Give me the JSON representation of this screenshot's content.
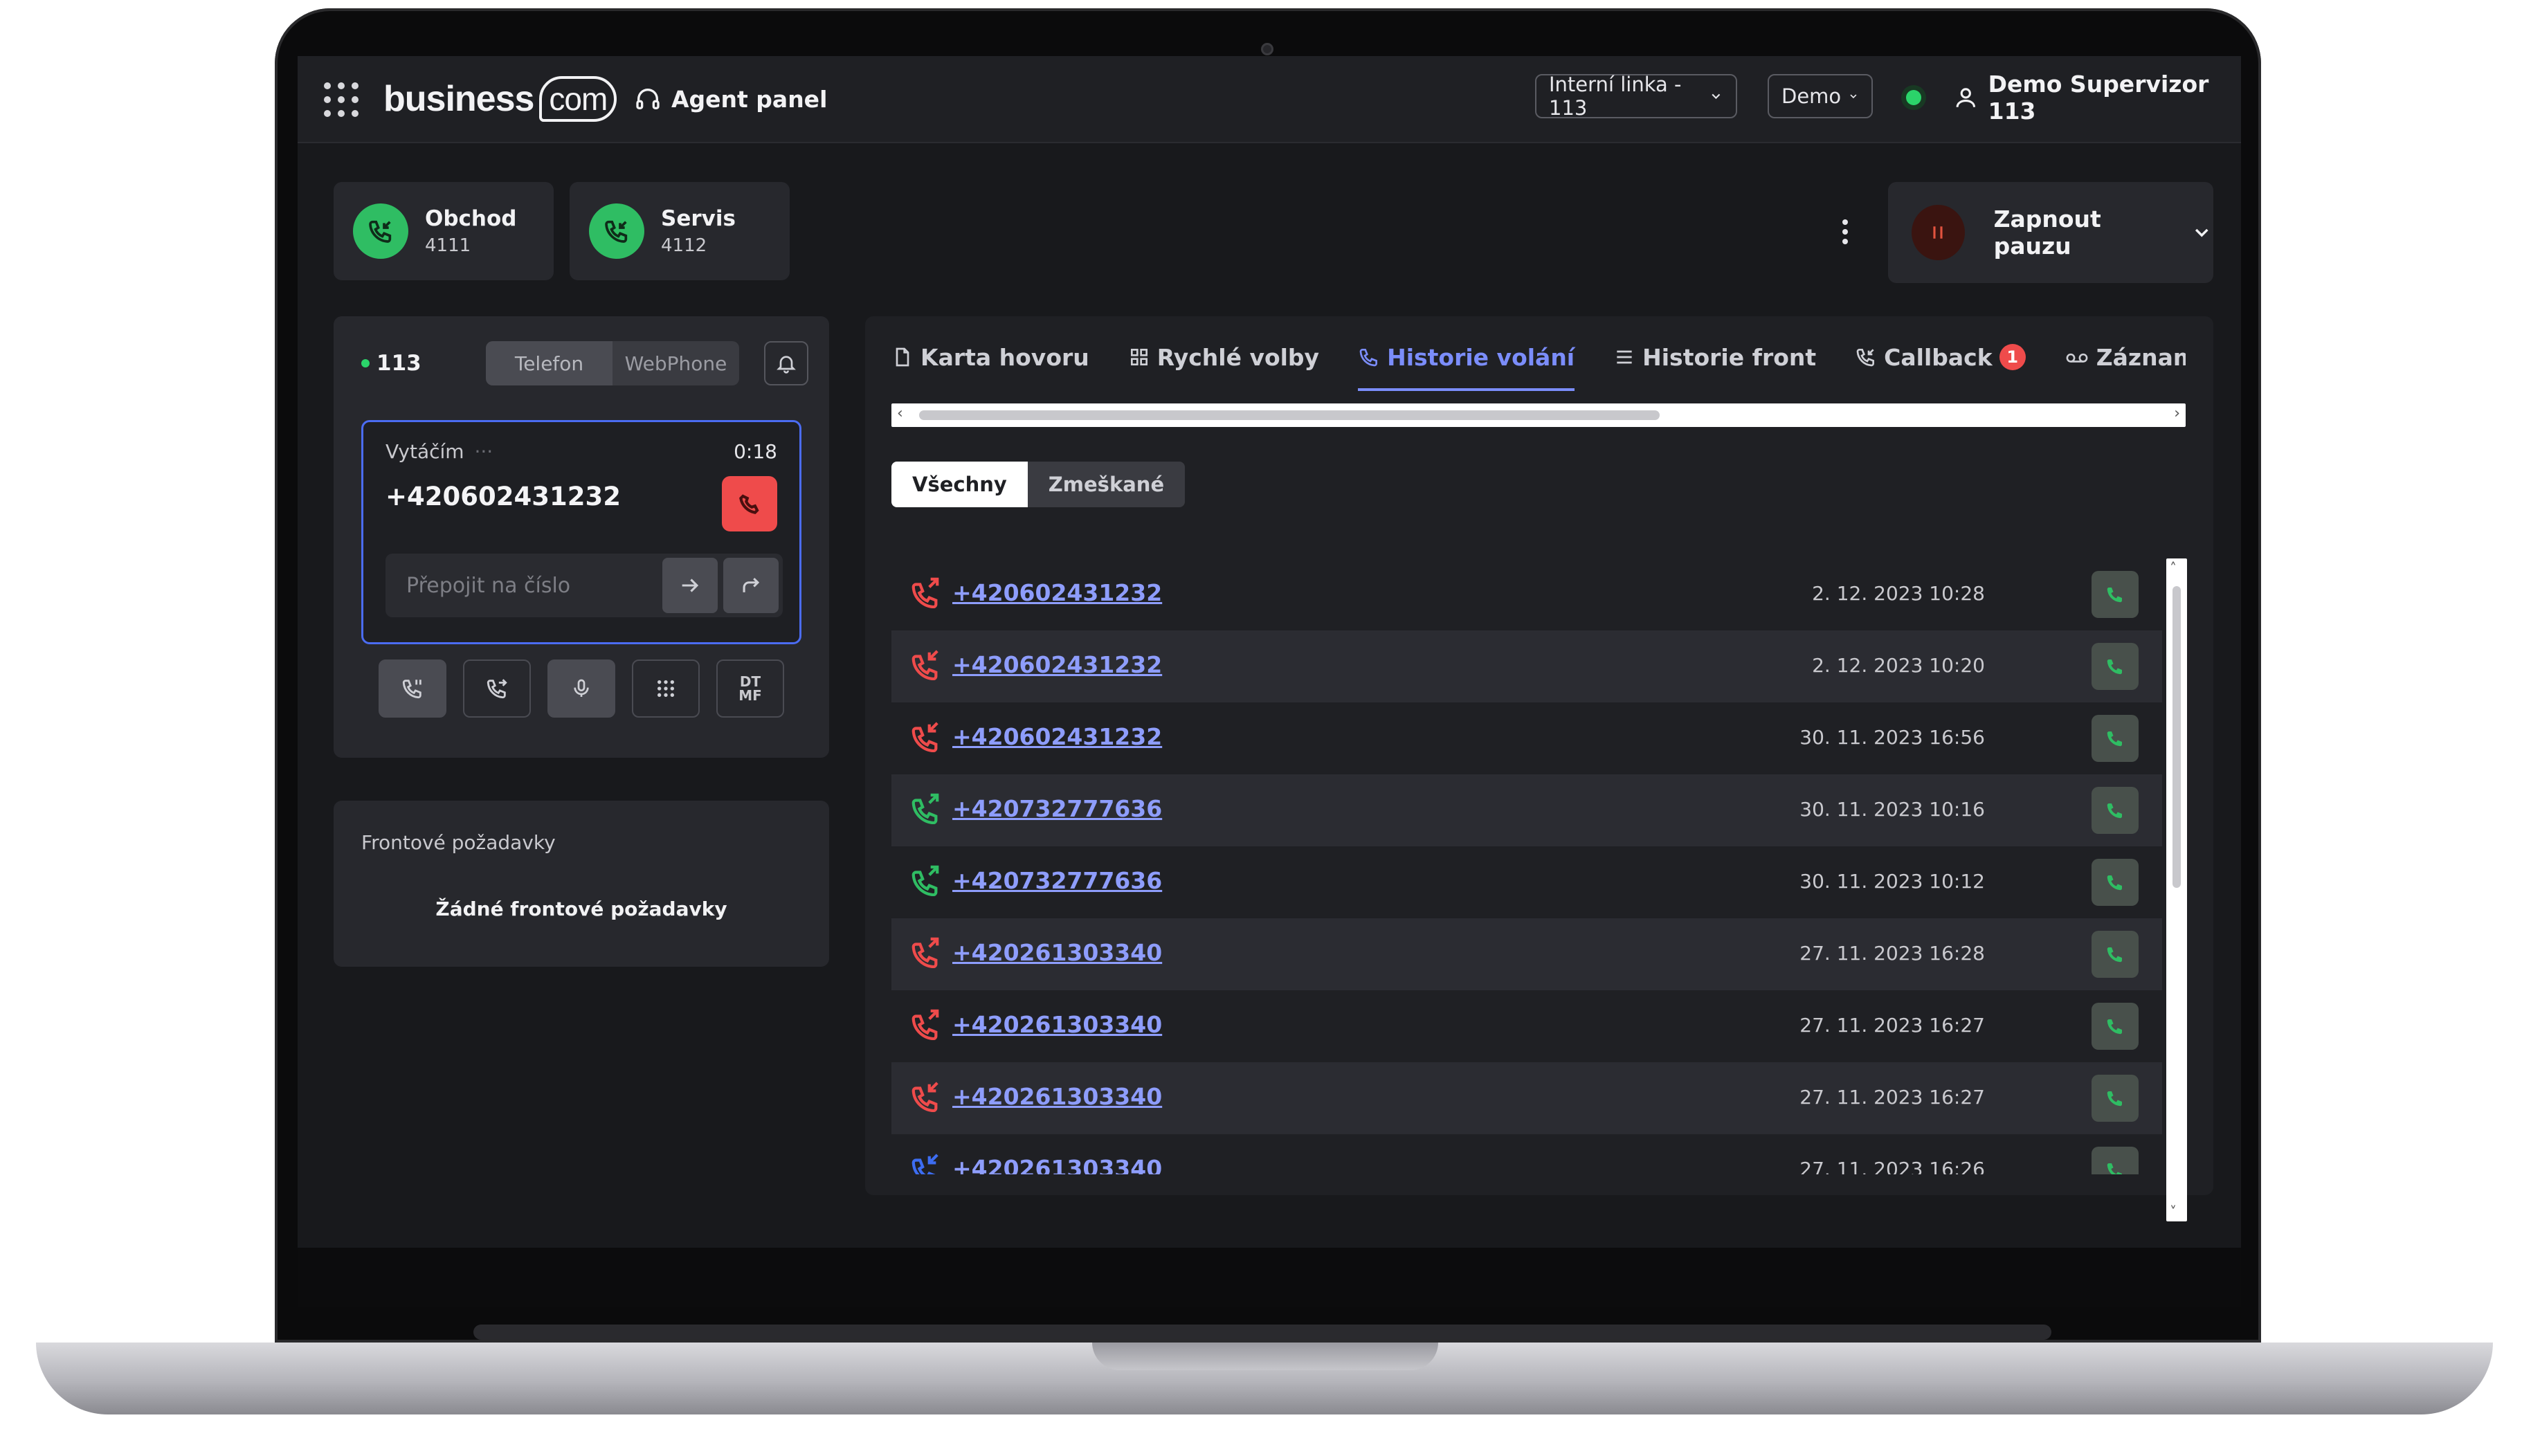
{
  "header": {
    "logo_main": "business",
    "logo_suffix": "com",
    "agent_panel_label": "Agent panel",
    "line_select": "Interní linka - 113",
    "profile_select": "Demo",
    "user_name": "Demo Supervizor 113"
  },
  "queues": [
    {
      "name": "Obchod",
      "number": "4111"
    },
    {
      "name": "Servis",
      "number": "4112"
    }
  ],
  "pause": {
    "label": "Zapnout pauzu"
  },
  "phone": {
    "extension": "113",
    "mode_tabs": [
      "Telefon",
      "WebPhone"
    ],
    "call": {
      "state": "Vytáčím",
      "state_dots": "···",
      "duration": "0:18",
      "number": "+420602431232"
    },
    "transfer_placeholder": "Přepojit na číslo",
    "dtmf_label_top": "DT",
    "dtmf_label_bottom": "MF"
  },
  "queue_requests": {
    "title": "Frontové požadavky",
    "empty": "Žádné frontové požadavky"
  },
  "tabs": [
    {
      "label": "Karta hovoru",
      "icon": "document-icon"
    },
    {
      "label": "Rychlé volby",
      "icon": "grid-icon"
    },
    {
      "label": "Historie volání",
      "icon": "phone-icon",
      "active": true
    },
    {
      "label": "Historie front",
      "icon": "list-icon"
    },
    {
      "label": "Callback",
      "icon": "callback-icon",
      "badge": "1"
    },
    {
      "label": "Záznamník",
      "icon": "voicemail-icon"
    }
  ],
  "filter": {
    "all": "Všechny",
    "missed": "Zmeškané"
  },
  "history": [
    {
      "number": "+420602431232",
      "date": "2. 12. 2023 10:28",
      "dir": "outgoing",
      "color": "#ef4b4b"
    },
    {
      "number": "+420602431232",
      "date": "2. 12. 2023 10:20",
      "dir": "incoming",
      "color": "#ef4b4b"
    },
    {
      "number": "+420602431232",
      "date": "30. 11. 2023 16:56",
      "dir": "incoming",
      "color": "#ef4b4b"
    },
    {
      "number": "+420732777636",
      "date": "30. 11. 2023 10:16",
      "dir": "outgoing",
      "color": "#2fbd63"
    },
    {
      "number": "+420732777636",
      "date": "30. 11. 2023 10:12",
      "dir": "outgoing",
      "color": "#2fbd63"
    },
    {
      "number": "+420261303340",
      "date": "27. 11. 2023 16:28",
      "dir": "outgoing",
      "color": "#ef4b4b"
    },
    {
      "number": "+420261303340",
      "date": "27. 11. 2023 16:27",
      "dir": "outgoing",
      "color": "#ef4b4b"
    },
    {
      "number": "+420261303340",
      "date": "27. 11. 2023 16:27",
      "dir": "incoming",
      "color": "#ef4b4b"
    },
    {
      "number": "+420261303340",
      "date": "27. 11. 2023 16:26",
      "dir": "incoming",
      "color": "#3d6df2"
    }
  ],
  "colors": {
    "accent": "#7b8dfb",
    "success": "#2fbd63",
    "danger": "#ef4b4b",
    "panel": "#27282d"
  }
}
